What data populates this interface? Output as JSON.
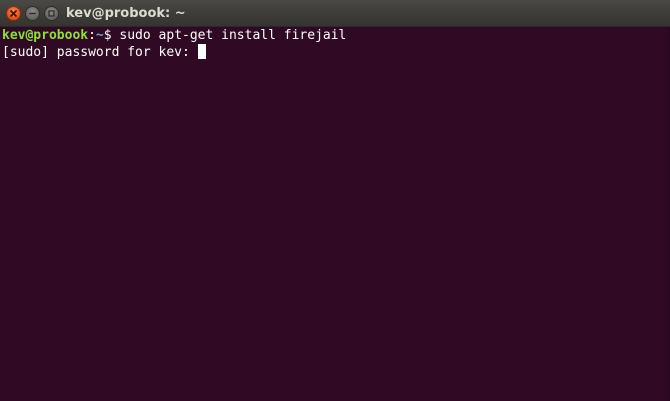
{
  "window": {
    "title": "kev@probook: ~"
  },
  "terminal": {
    "lines": [
      {
        "user_host": "kev@probook",
        "separator": ":",
        "path": "~",
        "prompt_char": "$ ",
        "command": "sudo apt-get install firejail"
      },
      {
        "text": "[sudo] password for kev: "
      }
    ]
  },
  "colors": {
    "background": "#300a24",
    "user_host": "#8ae234",
    "path": "#729fcf",
    "text": "#ffffff",
    "close_button": "#e95420"
  },
  "icons": {
    "close": "close-icon",
    "minimize": "minimize-icon",
    "maximize": "maximize-icon"
  }
}
